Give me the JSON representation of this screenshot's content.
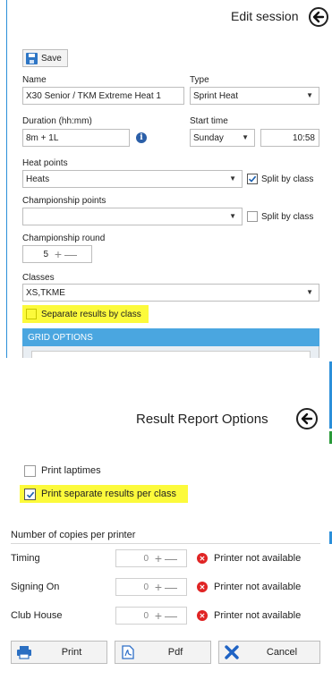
{
  "edit_session": {
    "title": "Edit session",
    "save_label": "Save",
    "name_label": "Name",
    "name_value": "X30 Senior / TKM Extreme Heat 1",
    "type_label": "Type",
    "type_value": "Sprint Heat",
    "duration_label": "Duration (hh:mm)",
    "duration_value": "8m + 1L",
    "start_time_label": "Start time",
    "start_day_value": "Sunday",
    "start_time_value": "10:58",
    "heat_points_label": "Heat points",
    "heat_points_value": "Heats",
    "heat_split_label": "Split by class",
    "heat_split_checked": true,
    "championship_points_label": "Championship points",
    "championship_points_value": "",
    "championship_split_label": "Split by class",
    "championship_split_checked": false,
    "championship_round_label": "Championship round",
    "championship_round_value": "5",
    "classes_label": "Classes",
    "classes_value": "XS,TKME",
    "separate_results_label": "Separate results by class",
    "separate_results_checked": false,
    "grid_options_header": "GRID OPTIONS"
  },
  "result_report": {
    "title": "Result Report Options",
    "print_laptimes_label": "Print laptimes",
    "print_laptimes_checked": false,
    "print_separate_label": "Print separate results per class",
    "print_separate_checked": true,
    "copies_label": "Number of copies per printer",
    "printers": [
      {
        "name": "Timing",
        "copies": "0",
        "status": "Printer not available"
      },
      {
        "name": "Signing On",
        "copies": "0",
        "status": "Printer not available"
      },
      {
        "name": "Club House",
        "copies": "0",
        "status": "Printer not available"
      }
    ],
    "buttons": {
      "print": "Print",
      "pdf": "Pdf",
      "cancel": "Cancel"
    }
  },
  "colors": {
    "accent_blue": "#2b8fd9",
    "grid_header": "#4aa6e0",
    "highlight": "#fcfa3b",
    "error_red": "#e02424",
    "pdf_blue": "#2e6fc8"
  }
}
